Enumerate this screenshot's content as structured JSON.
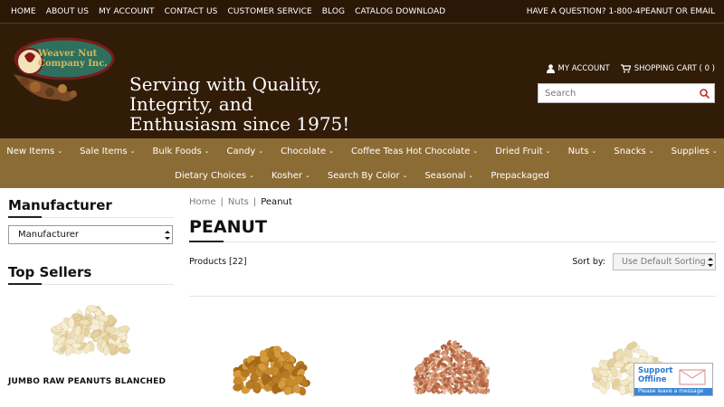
{
  "topbar": {
    "links": [
      "HOME",
      "ABOUT US",
      "MY ACCOUNT",
      "CONTACT US",
      "CUSTOMER SERVICE",
      "BLOG",
      "CATALOG DOWNLOAD"
    ],
    "contact": "HAVE A QUESTION? 1-800-4PEANUT OR EMAIL"
  },
  "header": {
    "logo_text": "Weaver Nut Company Inc.",
    "tagline": [
      "Serving with Quality,",
      "Integrity, and",
      "Enthusiasm since 1975!"
    ],
    "my_account": "MY ACCOUNT",
    "cart": "SHOPPING CART ( 0 )",
    "search_placeholder": "Search"
  },
  "nav": {
    "row1": [
      {
        "label": "New Items",
        "chevron": true
      },
      {
        "label": "Sale Items",
        "chevron": true
      },
      {
        "label": "Bulk Foods",
        "chevron": true
      },
      {
        "label": "Candy",
        "chevron": true
      },
      {
        "label": "Chocolate",
        "chevron": true
      },
      {
        "label": "Coffee Teas Hot Chocolate",
        "chevron": true
      },
      {
        "label": "Dried Fruit",
        "chevron": true
      },
      {
        "label": "Nuts",
        "chevron": true
      },
      {
        "label": "Snacks",
        "chevron": true
      },
      {
        "label": "Supplies",
        "chevron": true
      }
    ],
    "row2": [
      {
        "label": "Dietary Choices",
        "chevron": true
      },
      {
        "label": "Kosher",
        "chevron": true
      },
      {
        "label": "Search By Color",
        "chevron": true
      },
      {
        "label": "Seasonal",
        "chevron": true
      },
      {
        "label": "Prepackaged",
        "chevron": false
      }
    ]
  },
  "sidebar": {
    "manufacturer_heading": "Manufacturer",
    "manufacturer_select": "Manufacturer",
    "top_sellers_heading": "Top Sellers",
    "top_seller_name": "JUMBO RAW PEANUTS BLANCHED"
  },
  "main": {
    "breadcrumb": [
      "Home",
      "Nuts",
      "Peanut"
    ],
    "title": "PEANUT",
    "products_count": "Products [22]",
    "sort_label": "Sort by:",
    "sort_value": "Use Default Sorting"
  },
  "support": {
    "line1": "Support",
    "line2": "Offline",
    "bar": "Please leave a message"
  },
  "colors": {
    "topbar": "#2b1706",
    "header": "#311c08",
    "nav": "#8c6c35",
    "cart_icon": "#c62828"
  }
}
